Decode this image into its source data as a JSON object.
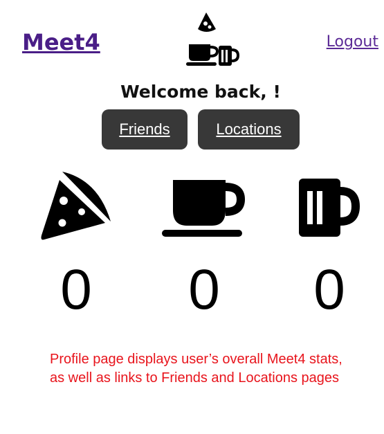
{
  "header": {
    "brand": "Meet4",
    "logout_label": "Logout"
  },
  "welcome": "Welcome back, !",
  "nav": {
    "friends_label": "Friends",
    "locations_label": "Locations"
  },
  "stats": [
    {
      "icon": "pizza-slice-icon",
      "count": "0"
    },
    {
      "icon": "coffee-cup-icon",
      "count": "0"
    },
    {
      "icon": "beer-mug-icon",
      "count": "0"
    }
  ],
  "caption": "Profile page displays user’s overall Meet4 stats, as well as links to Friends and Locations pages",
  "colors": {
    "brand": "#4a1e87",
    "button_bg": "#383838",
    "caption": "#e8141c"
  }
}
